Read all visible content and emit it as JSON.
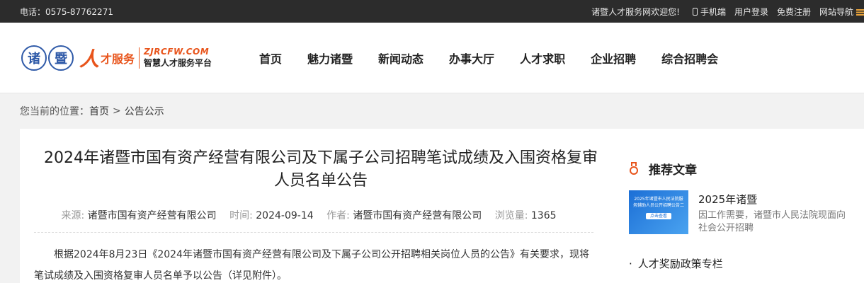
{
  "topbar": {
    "phone_label": "电话：",
    "phone_number": "0575-87762271",
    "welcome": "诸暨人才服务网欢迎您!",
    "mobile": "手机端",
    "login": "用户登录",
    "register": "免费注册",
    "site_nav": "网站导航"
  },
  "logo": {
    "seal1": "诸",
    "seal2": "暨",
    "ren": "人",
    "cai": "才服务",
    "domain": "ZJRCFW.COM",
    "slogan": "智慧人才服务平台"
  },
  "nav": [
    "首页",
    "魅力诸暨",
    "新闻动态",
    "办事大厅",
    "人才求职",
    "企业招聘",
    "综合招聘会"
  ],
  "breadcrumb": {
    "prefix": "您当前的位置：",
    "home": "首页",
    "separator": ">",
    "current": "公告公示"
  },
  "article": {
    "title": "2024年诸暨市国有资产经营有限公司及下属子公司招聘笔试成绩及入围资格复审 人员名单公告",
    "source_label": "来源:",
    "source": "诸暨市国有资产经营有限公司",
    "time_label": "时间:",
    "time": "2024-09-14",
    "author_label": "作者:",
    "author": "诸暨市国有资产经营有限公司",
    "views_label": "浏览量:",
    "views": "1365",
    "body": "根据2024年8月23日《2024年诸暨市国有资产经营有限公司及下属子公司公开招聘相关岗位人员的公告》有关要求，现将笔试成绩及入围资格复审人员名单予以公告（详见附件）。"
  },
  "sidebar": {
    "title": "推荐文章",
    "item": {
      "thumb_text": "2025年诸暨市人民法院服务辅助人员公开招聘公告二",
      "thumb_btn": "点击查看",
      "title": "2025年诸暨",
      "desc": "因工作需要，诸暨市人民法院现面向社会公开招聘"
    },
    "policy_dot": "·",
    "policy": "人才奖励政策专栏"
  },
  "colors": {
    "accent": "#e8541b",
    "logo_blue": "#2f5aa8",
    "topbar_bg": "#2c2c2c"
  }
}
